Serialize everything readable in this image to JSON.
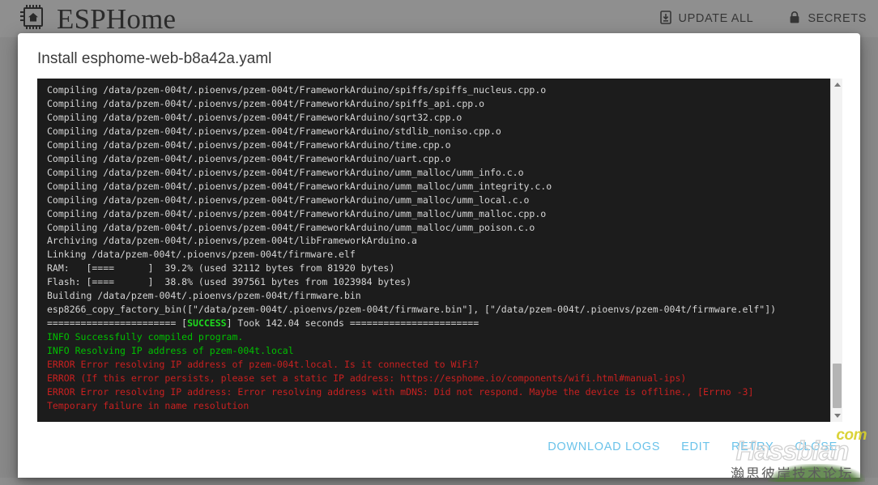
{
  "header": {
    "brand": "ESPHome",
    "logo_icon": "esphome-chip-house-icon",
    "actions": [
      {
        "label": "UPDATE ALL",
        "icon": "download-box-icon"
      },
      {
        "label": "SECRETS",
        "icon": "lock-icon"
      }
    ]
  },
  "dialog": {
    "title": "Install esphome-web-b8a42a.yaml",
    "actions": [
      {
        "id": "download-logs",
        "label": "DOWNLOAD LOGS"
      },
      {
        "id": "edit",
        "label": "EDIT"
      },
      {
        "id": "retry",
        "label": "RETRY"
      },
      {
        "id": "close",
        "label": "CLOSE"
      }
    ],
    "action_color": "#6bc3ea"
  },
  "console": {
    "background": "#1c1c1c",
    "default_color": "#d6d6d6",
    "info_color": "#00c000",
    "error_color": "#c82020",
    "success_color": "#1ddb1d",
    "scrollbar": {
      "visible": true,
      "position": "near-bottom"
    },
    "lines": [
      {
        "type": "plain",
        "text": "Compiling /data/pzem-004t/.pioenvs/pzem-004t/FrameworkArduino/spiffs/spiffs_nucleus.cpp.o"
      },
      {
        "type": "plain",
        "text": "Compiling /data/pzem-004t/.pioenvs/pzem-004t/FrameworkArduino/spiffs_api.cpp.o"
      },
      {
        "type": "plain",
        "text": "Compiling /data/pzem-004t/.pioenvs/pzem-004t/FrameworkArduino/sqrt32.cpp.o"
      },
      {
        "type": "plain",
        "text": "Compiling /data/pzem-004t/.pioenvs/pzem-004t/FrameworkArduino/stdlib_noniso.cpp.o"
      },
      {
        "type": "plain",
        "text": "Compiling /data/pzem-004t/.pioenvs/pzem-004t/FrameworkArduino/time.cpp.o"
      },
      {
        "type": "plain",
        "text": "Compiling /data/pzem-004t/.pioenvs/pzem-004t/FrameworkArduino/uart.cpp.o"
      },
      {
        "type": "plain",
        "text": "Compiling /data/pzem-004t/.pioenvs/pzem-004t/FrameworkArduino/umm_malloc/umm_info.c.o"
      },
      {
        "type": "plain",
        "text": "Compiling /data/pzem-004t/.pioenvs/pzem-004t/FrameworkArduino/umm_malloc/umm_integrity.c.o"
      },
      {
        "type": "plain",
        "text": "Compiling /data/pzem-004t/.pioenvs/pzem-004t/FrameworkArduino/umm_malloc/umm_local.c.o"
      },
      {
        "type": "plain",
        "text": "Compiling /data/pzem-004t/.pioenvs/pzem-004t/FrameworkArduino/umm_malloc/umm_malloc.cpp.o"
      },
      {
        "type": "plain",
        "text": "Compiling /data/pzem-004t/.pioenvs/pzem-004t/FrameworkArduino/umm_malloc/umm_poison.c.o"
      },
      {
        "type": "plain",
        "text": "Archiving /data/pzem-004t/.pioenvs/pzem-004t/libFrameworkArduino.a"
      },
      {
        "type": "plain",
        "text": "Linking /data/pzem-004t/.pioenvs/pzem-004t/firmware.elf"
      },
      {
        "type": "plain",
        "text": "RAM:   [====      ]  39.2% (used 32112 bytes from 81920 bytes)"
      },
      {
        "type": "plain",
        "text": "Flash: [====      ]  38.8% (used 397561 bytes from 1023984 bytes)"
      },
      {
        "type": "plain",
        "text": "Building /data/pzem-004t/.pioenvs/pzem-004t/firmware.bin"
      },
      {
        "type": "plain",
        "text": "esp8266_copy_factory_bin([\"/data/pzem-004t/.pioenvs/pzem-004t/firmware.bin\"], [\"/data/pzem-004t/.pioenvs/pzem-004t/firmware.elf\"])"
      },
      {
        "type": "success",
        "pre": "======================= [",
        "token": "SUCCESS",
        "post": "] Took 142.04 seconds ======================="
      },
      {
        "type": "info",
        "text": "INFO Successfully compiled program."
      },
      {
        "type": "info",
        "text": "INFO Resolving IP address of pzem-004t.local"
      },
      {
        "type": "error",
        "text": "ERROR Error resolving IP address of pzem-004t.local. Is it connected to WiFi?"
      },
      {
        "type": "error",
        "text": "ERROR (If this error persists, please set a static IP address: https://esphome.io/components/wifi.html#manual-ips)"
      },
      {
        "type": "error",
        "text": "ERROR Error resolving IP address: Error resolving address with mDNS: Did not respond. Maybe the device is offline., [Errno -3]"
      },
      {
        "type": "error",
        "text": "Temporary failure in name resolution"
      }
    ]
  },
  "watermark": {
    "suffix": "com",
    "main": "Hassbian",
    "subtitle": "瀚思彼岸技术论坛"
  }
}
